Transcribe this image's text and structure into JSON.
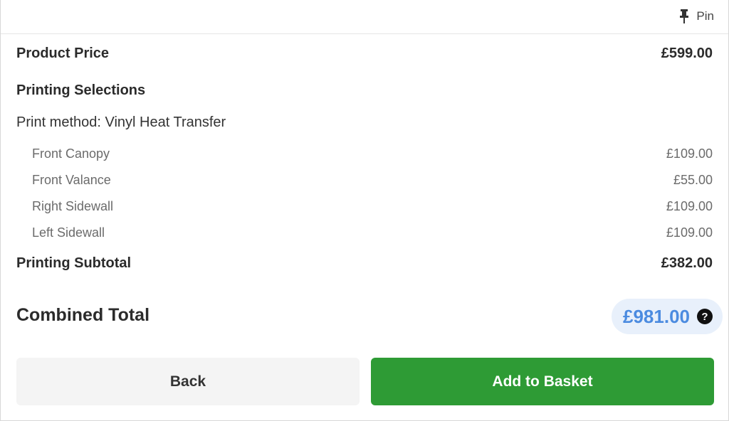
{
  "topbar": {
    "pin_label": "Pin",
    "pin_icon": "pin-icon"
  },
  "summary": {
    "product_price_label": "Product Price",
    "product_price_value": "£599.00",
    "printing_selections_label": "Printing Selections",
    "print_method": "Print method: Vinyl Heat Transfer",
    "items": [
      {
        "label": "Front Canopy",
        "price": "£109.00"
      },
      {
        "label": "Front Valance",
        "price": "£55.00"
      },
      {
        "label": "Right Sidewall",
        "price": "£109.00"
      },
      {
        "label": "Left Sidewall",
        "price": "£109.00"
      }
    ],
    "printing_subtotal_label": "Printing Subtotal",
    "printing_subtotal_value": "£382.00",
    "combined_total_label": "Combined Total",
    "combined_total_value": "£981.00",
    "help_icon": "question-circle-icon"
  },
  "actions": {
    "back_label": "Back",
    "add_label": "Add to Basket"
  },
  "colors": {
    "accent_total": "#4b8be0",
    "total_pill_bg": "#e8f0fb",
    "add_button": "#2e9b35",
    "back_button": "#f4f4f4"
  }
}
